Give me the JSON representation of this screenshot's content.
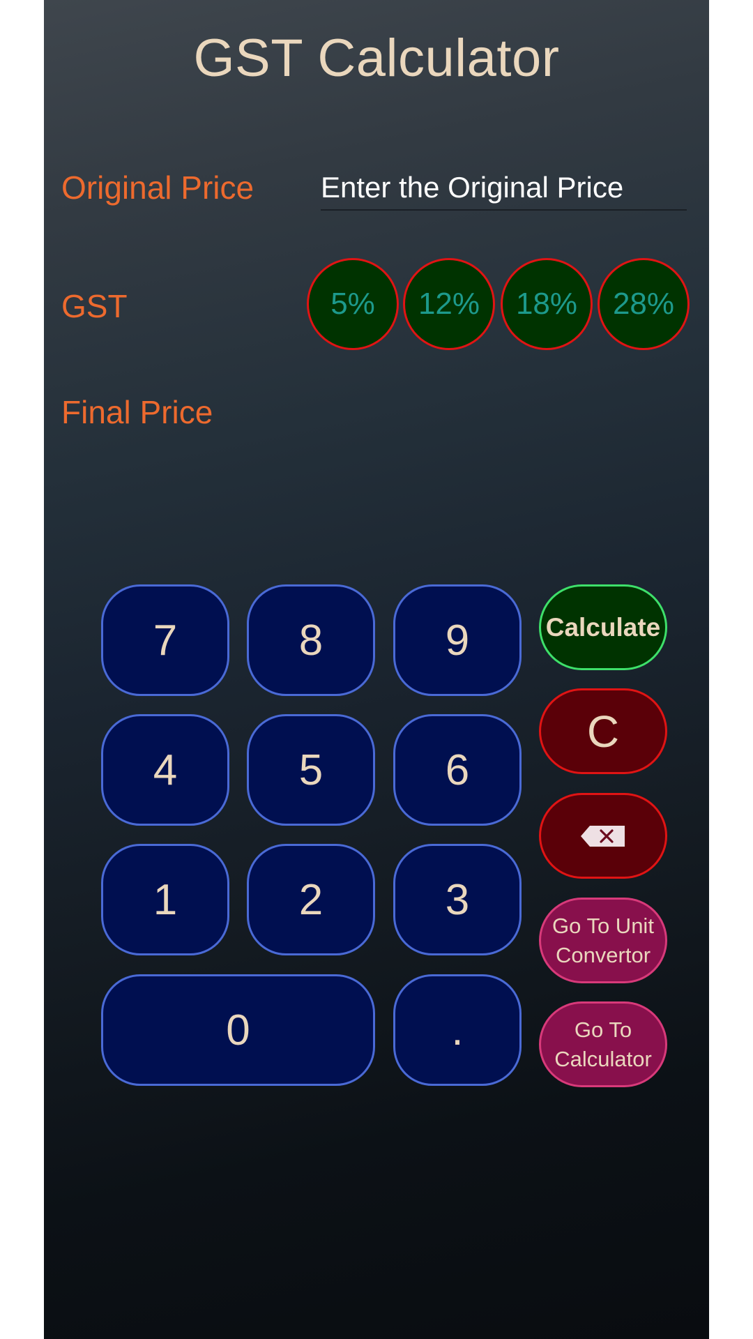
{
  "app": {
    "title": "GST Calculator"
  },
  "form": {
    "original_price_label": "Original Price",
    "original_price_value": "",
    "original_price_placeholder": "Enter the Original Price",
    "gst_label": "GST",
    "gst_options": [
      "5%",
      "12%",
      "18%",
      "28%"
    ],
    "final_price_label": "Final Price",
    "final_price_value": ""
  },
  "keypad": {
    "keys": [
      "7",
      "8",
      "9",
      "4",
      "5",
      "6",
      "1",
      "2",
      "3",
      "0",
      "."
    ]
  },
  "actions": {
    "calculate_label": "Calculate",
    "clear_label": "C",
    "backspace_icon": "backspace-icon",
    "unit_convertor_label_line1": "Go To Unit",
    "unit_convertor_label_line2": "Convertor",
    "calculator_label_line1": "Go To",
    "calculator_label_line2": "Calculator"
  },
  "colors": {
    "label_orange": "#ed6a2e",
    "title_cream": "#ead7bd",
    "gst_text_teal": "#1d9a8c",
    "gst_chip_fill": "#003300",
    "gst_chip_border": "#e01414",
    "key_fill": "#000f50",
    "key_border": "#4a6ad6",
    "calculate_border": "#3ee06a",
    "clear_fill": "#5a0008",
    "nav_fill": "#88104c"
  }
}
